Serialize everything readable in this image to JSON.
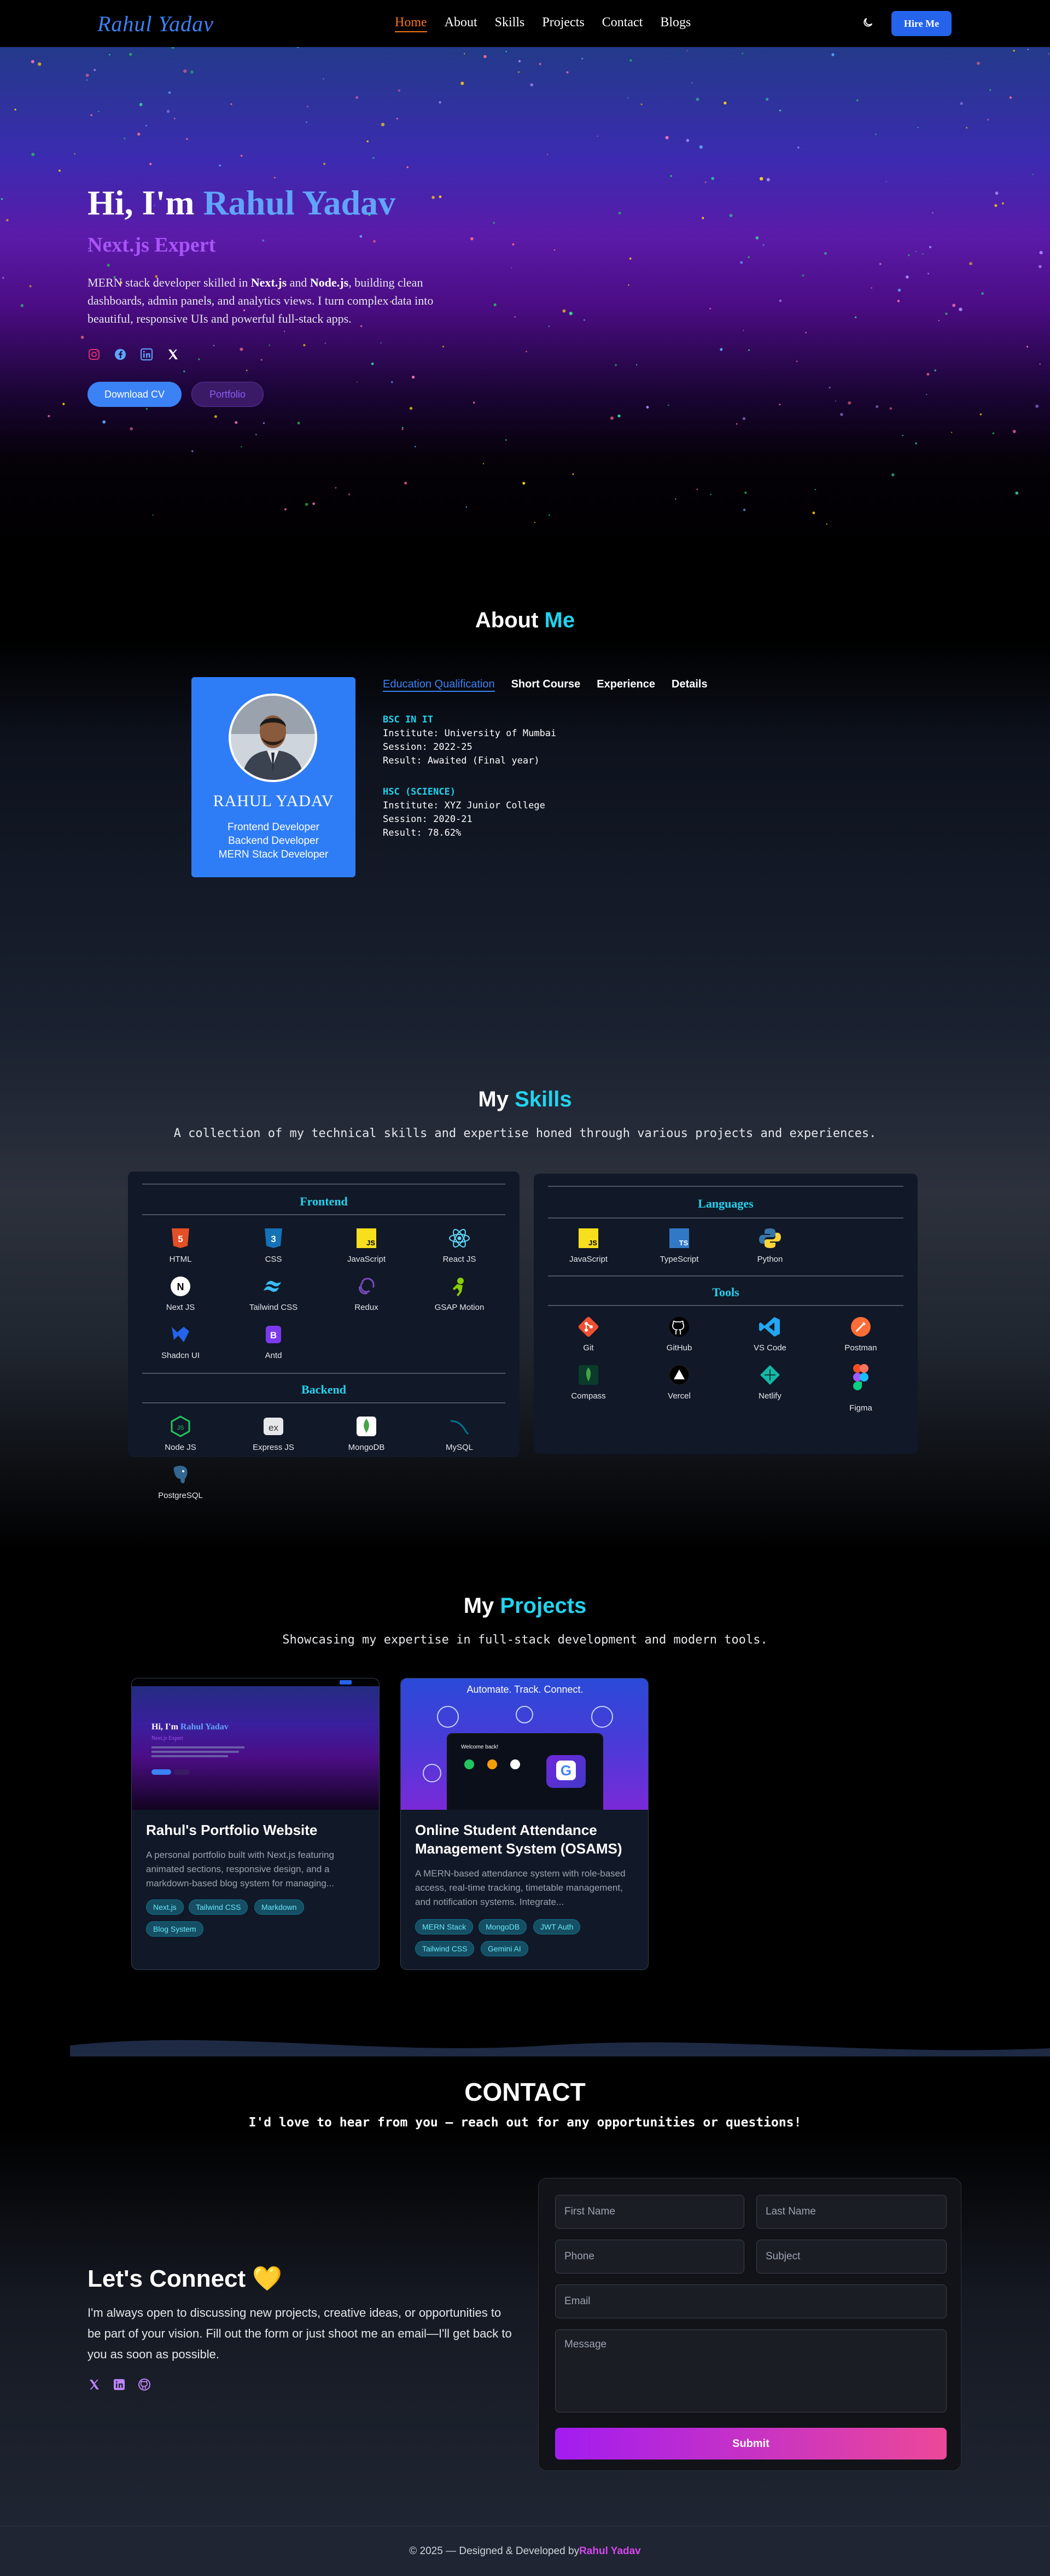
{
  "nav": {
    "logo": "Rahul Yadav",
    "links": [
      "Home",
      "About",
      "Skills",
      "Projects",
      "Contact",
      "Blogs"
    ],
    "active": "Home",
    "theme_icon": "moon-icon",
    "hire_label": "Hire Me"
  },
  "hero": {
    "greeting": "Hi, I'm ",
    "name": "Rahul Yadav",
    "subtitle": "Next.js Expert",
    "desc_1": "MERN stack developer skilled in ",
    "desc_b1": "Next.js",
    "desc_2": " and ",
    "desc_b2": "Node.js",
    "desc_3": ", building clean dashboards, admin panels, and analytics views. I turn complex data into beautiful, responsive UIs and powerful full-stack apps.",
    "social_icons": [
      "instagram-icon",
      "facebook-icon",
      "linkedin-icon",
      "x-icon"
    ],
    "cv_label": "Download CV",
    "portfolio_label": "Portfolio"
  },
  "about": {
    "title_a": "About ",
    "title_b": "Me",
    "name": "RAHUL YADAV",
    "roles": [
      "Frontend Developer",
      "Backend Developer",
      "MERN Stack Developer"
    ],
    "tabs": [
      "Education Qualification",
      "Short Course",
      "Experience",
      "Details"
    ],
    "education": [
      {
        "degree": "BSC IN IT",
        "institute": "Institute: University of Mumbai",
        "session": "Session: 2022-25",
        "result": "Result: Awaited (Final year)"
      },
      {
        "degree": "HSC (SCIENCE)",
        "institute": "Institute: XYZ Junior College",
        "session": "Session: 2020-21",
        "result": "Result: 78.62%"
      }
    ]
  },
  "skills": {
    "title_a": "My ",
    "title_b": "Skills",
    "subtitle": "A collection of my technical skills and expertise honed through various projects and experiences.",
    "frontend_title": "Frontend",
    "frontend": [
      "HTML",
      "CSS",
      "JavaScript",
      "React JS",
      "Next JS",
      "Tailwind CSS",
      "Redux",
      "GSAP Motion",
      "Shadcn UI",
      "Antd"
    ],
    "backend_title": "Backend",
    "backend": [
      "Node JS",
      "Express JS",
      "MongoDB",
      "MySQL",
      "PostgreSQL"
    ],
    "languages_title": "Languages",
    "languages": [
      "JavaScript",
      "TypeScript",
      "Python"
    ],
    "tools_title": "Tools",
    "tools": [
      "Git",
      "GitHub",
      "VS Code",
      "Postman",
      "Compass",
      "Vercel",
      "Netlify",
      "Figma"
    ]
  },
  "projects": {
    "title_a": "My ",
    "title_b": "Projects",
    "subtitle": "Showcasing my expertise in full-stack development and modern tools.",
    "items": [
      {
        "title": "Rahul's Portfolio Website",
        "desc": "A personal portfolio built with Next.js featuring animated sections, responsive design, and a markdown-based blog system for managing...",
        "tags": [
          "Next.js",
          "Tailwind CSS",
          "Markdown",
          "Blog System"
        ],
        "thumb_title_a": "Hi, I'm ",
        "thumb_title_b": "Rahul Yadav",
        "thumb_sub": "Next.js Expert"
      },
      {
        "title": "Online Student Attendance Management System (OSAMS)",
        "desc": "A MERN-based attendance system with role-based access, real-time tracking, timetable management, and notification systems. Integrate...",
        "tags": [
          "MERN Stack",
          "MongoDB",
          "JWT Auth",
          "Tailwind CSS",
          "Gemini AI"
        ],
        "thumb_banner": "Automate. Track. Connect.",
        "thumb_welcome": "Welcome back!"
      }
    ]
  },
  "contact": {
    "title": "CONTACT",
    "subtitle": "I'd love to hear from you — reach out for any opportunities or questions!",
    "connect_title": "Let's Connect",
    "connect_emoji": "💛",
    "connect_desc": "I'm always open to discussing new projects, creative ideas, or opportunities to be part of your vision. Fill out the form or just shoot me an email—I'll get back to you as soon as possible.",
    "social_icons": [
      "x-icon",
      "linkedin-icon",
      "github-icon"
    ],
    "form": {
      "first_name": "First Name",
      "last_name": "Last Name",
      "phone": "Phone",
      "subject": "Subject",
      "email": "Email",
      "message": "Message",
      "submit": "Submit"
    }
  },
  "footer": {
    "text": "© 2025 — Designed & Developed by ",
    "author": "Rahul Yadav"
  },
  "colors": {
    "accent_blue": "#3b82f6",
    "accent_cyan": "#22d3ee",
    "accent_purple": "#a855f7",
    "nav_active": "#f97316"
  }
}
